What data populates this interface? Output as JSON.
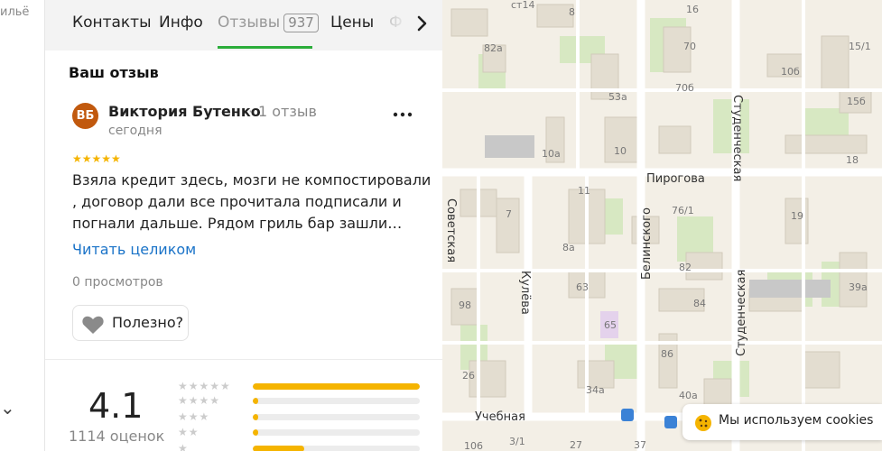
{
  "left_sliver": {
    "text": "ильё",
    "cut_char": "⌄"
  },
  "tabs": [
    {
      "label": "Контакты"
    },
    {
      "label": "Инфо"
    },
    {
      "label": "Отзывы",
      "badge": "937",
      "active": true
    },
    {
      "label": "Цены"
    },
    {
      "label": "Ф"
    }
  ],
  "review": {
    "section_title": "Ваш отзыв",
    "avatar_initials": "ВБ",
    "avatar_color": "#c1590e",
    "author": "Виктория Бутенко",
    "separator": "·",
    "author_reviews": "1 отзыв",
    "date": "сегодня",
    "stars": "★★★★★",
    "text": "Взяла кредит здесь, мозги не компостировали , договор дали все прочитала подписали и погнали дальше. Рядом гриль бар зашли…",
    "read_more": "Читать целиком",
    "views": "0 просмотров",
    "helpful": "Полезно?"
  },
  "rating": {
    "value": "4.1",
    "total": "1114 оценок",
    "distribution": [
      {
        "stars": "★★★★★",
        "fraction": 1.0
      },
      {
        "stars": "★★★★",
        "fraction": 0.03
      },
      {
        "stars": "★★★",
        "fraction": 0.035
      },
      {
        "stars": "★★",
        "fraction": 0.035
      },
      {
        "stars": "★",
        "fraction": 0.31
      }
    ]
  },
  "map": {
    "streets": [
      "Пирогова",
      "Студенческая",
      "Белинского",
      "Кулёва",
      "Учебная",
      "Студенческая",
      "Советская"
    ],
    "buildings": [
      "ст14",
      "82а",
      "70",
      "10б",
      "15/1",
      "53а",
      "70б",
      "15б",
      "10а",
      "10",
      "18",
      "11",
      "76/1",
      "7",
      "19",
      "8а",
      "82",
      "63",
      "39а",
      "98",
      "65",
      "84",
      "86",
      "26",
      "34а",
      "40а",
      "106",
      "3/1",
      "27",
      "37",
      "8",
      "16"
    ]
  },
  "cookie": {
    "text": "Мы используем cookies"
  },
  "colors": {
    "accent_green": "#2bad3a",
    "star": "#f5b400",
    "link": "#1a73c8"
  }
}
